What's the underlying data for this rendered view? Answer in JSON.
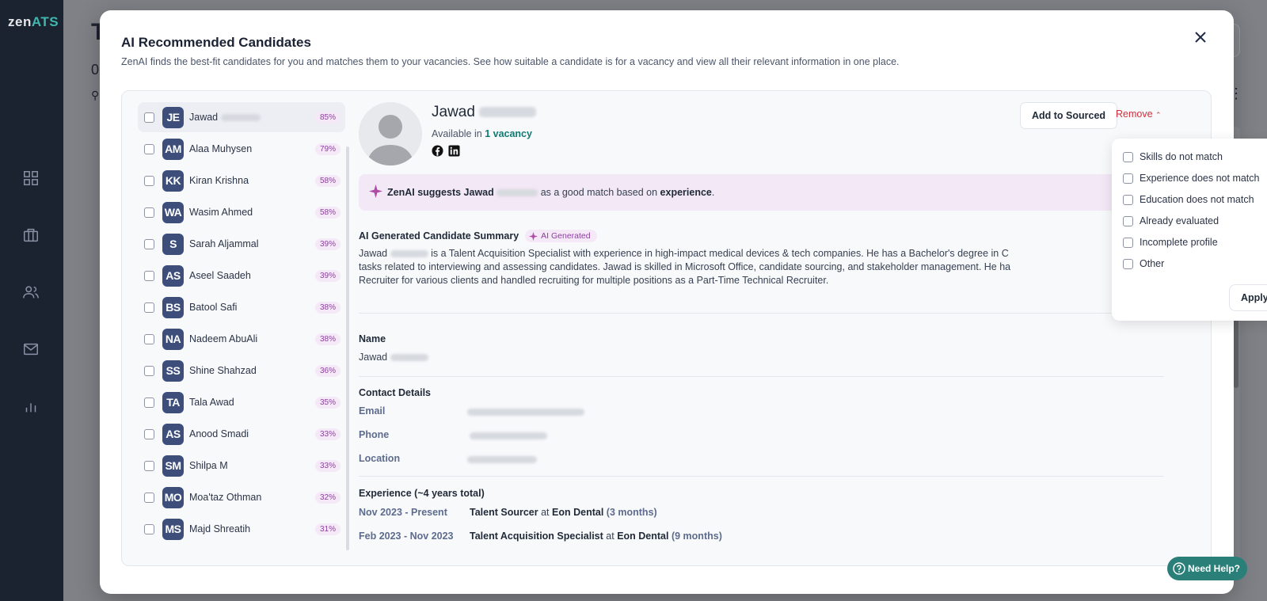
{
  "app": {
    "logo_zen": "zen",
    "logo_ats": "ATS",
    "bg_title": "T",
    "bg_sub": "0"
  },
  "modal": {
    "title": "AI Recommended Candidates",
    "description": "ZenAI finds the best-fit candidates for you and matches them to your vacancies. See how suitable a candidate is for a vacancy and view all their relevant information in one place."
  },
  "candidates": [
    {
      "initials": "JE",
      "name": "Jawad",
      "pct": "85%",
      "selected": true
    },
    {
      "initials": "AM",
      "name": "Alaa Muhysen",
      "pct": "79%"
    },
    {
      "initials": "KK",
      "name": "Kiran Krishna",
      "pct": "58%"
    },
    {
      "initials": "WA",
      "name": "Wasim Ahmed",
      "pct": "58%"
    },
    {
      "initials": "S",
      "name": "Sarah Aljammal",
      "pct": "39%"
    },
    {
      "initials": "AS",
      "name": "Aseel Saadeh",
      "pct": "39%"
    },
    {
      "initials": "BS",
      "name": "Batool Safi",
      "pct": "38%"
    },
    {
      "initials": "NA",
      "name": "Nadeem AbuAli",
      "pct": "38%"
    },
    {
      "initials": "SS",
      "name": "Shine Shahzad",
      "pct": "36%"
    },
    {
      "initials": "TA",
      "name": "Tala Awad",
      "pct": "35%"
    },
    {
      "initials": "AS",
      "name": "Anood Smadi",
      "pct": "33%"
    },
    {
      "initials": "SM",
      "name": "Shilpa M",
      "pct": "33%"
    },
    {
      "initials": "MO",
      "name": "Moa'taz Othman",
      "pct": "32%"
    },
    {
      "initials": "MS",
      "name": "Majd Shreatih",
      "pct": "31%"
    }
  ],
  "detail": {
    "name_first": "Jawad",
    "available_prefix": "Available in",
    "available_link": "1 vacancy",
    "add_button": "Add to Sourced",
    "remove_button": "Remove",
    "suggest_prefix": "ZenAI suggests Jawad",
    "suggest_mid": "as a good match based on",
    "suggest_key": "experience",
    "suggest_end": ".",
    "summary_heading": "AI Generated Candidate Summary",
    "ai_chip": "AI Generated",
    "summary_l1a": "Jawad",
    "summary_l1b": "is a Talent Acquisition Specialist with experience in high-impact medical devices & tech companies. He has a Bachelor's degree in C",
    "summary_l2": "tasks related to interviewing and assessing candidates. Jawad is skilled in Microsoft Office, candidate sourcing, and stakeholder management. He ha",
    "summary_l3": "Recruiter for various clients and handled recruiting for multiple positions as a Part-Time Technical Recruiter.",
    "name_label": "Name",
    "name_value": "Jawad",
    "contact_label": "Contact Details",
    "email_label": "Email",
    "phone_label": "Phone",
    "location_label": "Location",
    "experience_label": "Experience (~4 years total)",
    "experience": [
      {
        "dates": "Nov 2023 - Present",
        "title": "Talent Sourcer",
        "at": "at",
        "company": "Eon Dental",
        "duration": "(3 months)"
      },
      {
        "dates": "Feb 2023 - Nov 2023",
        "title": "Talent Acquisition Specialist",
        "at": "at",
        "company": "Eon Dental",
        "duration": "(9 months)"
      }
    ]
  },
  "remove_reasons": {
    "options": [
      "Skills do not match",
      "Experience does not match",
      "Education does not match",
      "Already evaluated",
      "Incomplete profile",
      "Other"
    ],
    "apply": "Apply"
  },
  "help": {
    "label": "Need Help?"
  }
}
